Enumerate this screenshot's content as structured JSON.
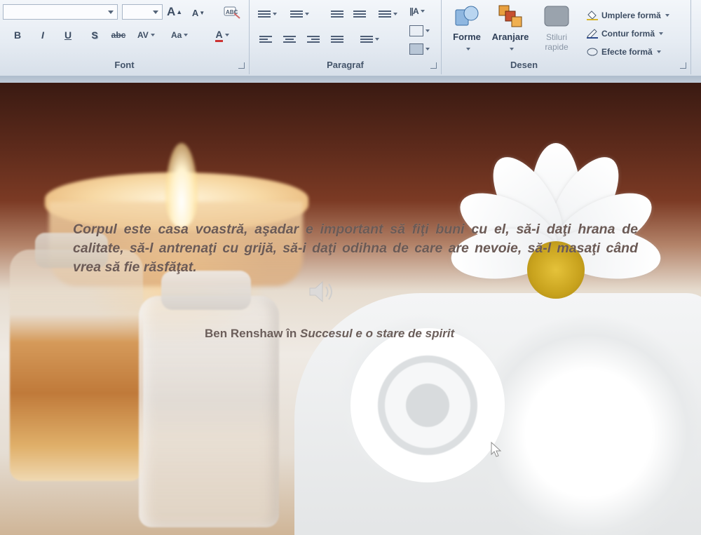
{
  "ribbon": {
    "groups": {
      "font": {
        "label": "Font",
        "grow_font_label": "A",
        "shrink_font_label": "A",
        "bold_label": "B",
        "italic_label": "I",
        "underline_label": "U",
        "shadow_label": "S",
        "strikethrough_label": "abc",
        "spacing_label": "AV",
        "case_label": "Aa",
        "color_label": "A"
      },
      "paragraph": {
        "label": "Paragraf"
      },
      "drawing": {
        "label": "Desen",
        "shapes_label": "Forme",
        "arrange_label": "Aranjare",
        "quick_styles_label": "Stiluri rapide",
        "shape_fill_label": "Umplere formă",
        "shape_outline_label": "Contur formă",
        "shape_effects_label": "Efecte formă"
      }
    }
  },
  "slide": {
    "quote": "Corpul este casa voastră, aşadar e important să fiţi buni cu el, să-i daţi hrana de calitate, să-l antrenaţi cu grijă, să-i daţi odihna de care are nevoie, să-l masaţi când vrea să fie răsfăţat.",
    "author": "Ben Renshaw în ",
    "book": "Succesul e o stare de spirit"
  },
  "colors": {
    "ribbon_text": "#3d4d63",
    "slide_text": "#6b5a55",
    "accent_yellow": "#d8b52c"
  }
}
